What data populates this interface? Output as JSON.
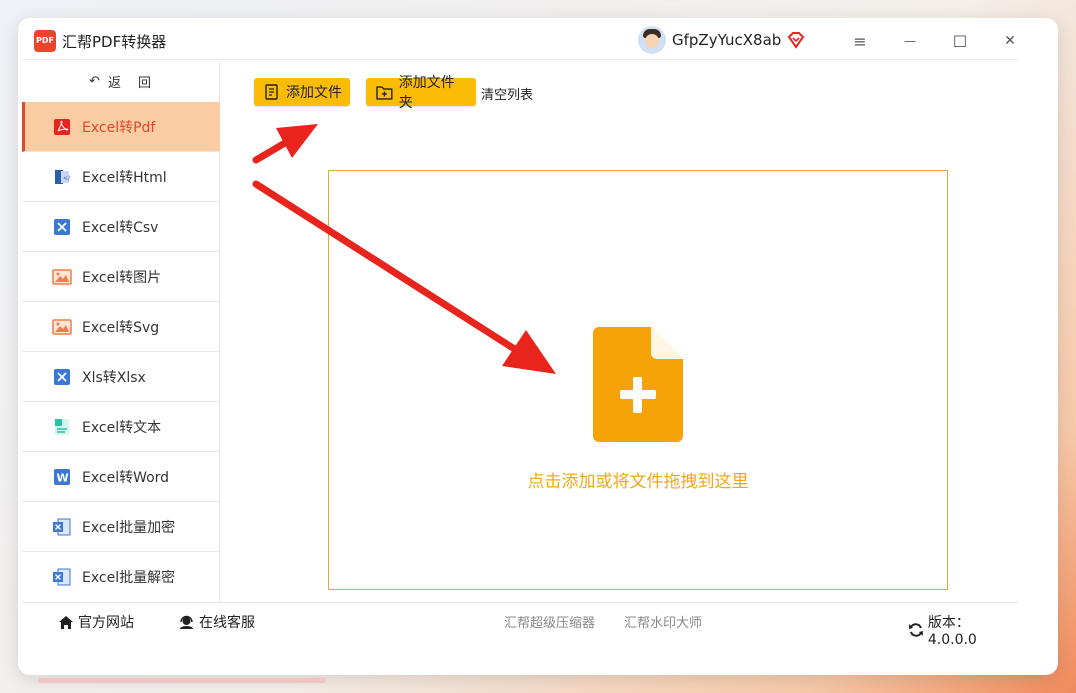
{
  "app": {
    "title": "汇帮PDF转换器",
    "logo_text": "PDF"
  },
  "user": {
    "name": "GfpZyYucX8ab"
  },
  "window_controls": {
    "menu": "≡",
    "minimize": "—",
    "maximize": "☐",
    "close": "✕"
  },
  "sidebar": {
    "back_label": "返　回",
    "items": [
      {
        "label": "Excel转Pdf",
        "icon": "pdf-icon",
        "active": true
      },
      {
        "label": "Excel转Html",
        "icon": "html-icon"
      },
      {
        "label": "Excel转Csv",
        "icon": "excel-x-icon"
      },
      {
        "label": "Excel转图片",
        "icon": "image-icon"
      },
      {
        "label": "Excel转Svg",
        "icon": "image-icon"
      },
      {
        "label": "Xls转Xlsx",
        "icon": "excel-x-icon"
      },
      {
        "label": "Excel转文本",
        "icon": "text-file-icon"
      },
      {
        "label": "Excel转Word",
        "icon": "word-icon"
      },
      {
        "label": "Excel批量加密",
        "icon": "excel-doc-icon"
      },
      {
        "label": "Excel批量解密",
        "icon": "excel-doc-icon"
      }
    ]
  },
  "toolbar": {
    "add_file": "添加文件",
    "add_folder": "添加文件夹",
    "clear_list": "清空列表"
  },
  "dropzone": {
    "hint": "点击添加或将文件拖拽到这里"
  },
  "footer": {
    "website": "官方网站",
    "support": "在线客服",
    "link_compressor": "汇帮超级压缩器",
    "link_watermark": "汇帮水印大师",
    "version_label": "版本：4.0.0.0"
  },
  "colors": {
    "accent": "#fbbc05",
    "active_bg": "#fccda3",
    "active_text": "#e8452c",
    "drop_text": "#f0a81a",
    "arrow_red": "#e8241c"
  }
}
